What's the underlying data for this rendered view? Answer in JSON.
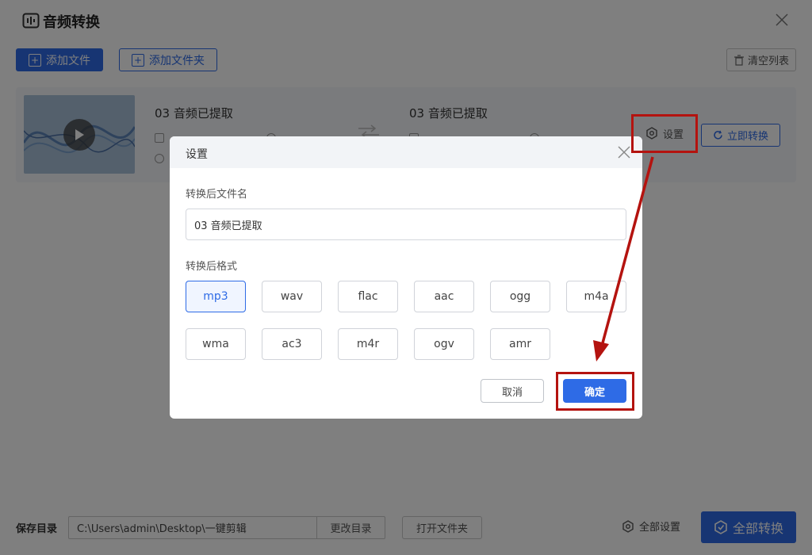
{
  "app": {
    "title": "音频转换",
    "add_file": "添加文件",
    "add_folder": "添加文件夹",
    "clear_list": "清空列表"
  },
  "file": {
    "source_name": "03 音频已提取",
    "target_name": "03 音频已提取",
    "settings_label": "设置",
    "convert_now_label": "立即转换"
  },
  "footer": {
    "save_dir_label": "保存目录",
    "save_dir_value": "C:\\Users\\admin\\Desktop\\一键剪辑",
    "change_dir": "更改目录",
    "open_folder": "打开文件夹",
    "all_settings": "全部设置",
    "convert_all": "全部转换"
  },
  "dialog": {
    "title": "设置",
    "filename_label": "转换后文件名",
    "filename_value": "03 音频已提取",
    "format_label": "转换后格式",
    "formats_row1": [
      "mp3",
      "wav",
      "flac",
      "aac",
      "ogg",
      "m4a"
    ],
    "formats_row2": [
      "wma",
      "ac3",
      "m4r",
      "ogv",
      "amr"
    ],
    "selected_format": "mp3",
    "cancel": "取消",
    "confirm": "确定"
  },
  "colors": {
    "accent": "#2e6be6",
    "highlight": "#b4130f",
    "overlay": "rgba(0,0,0,0.5)"
  }
}
